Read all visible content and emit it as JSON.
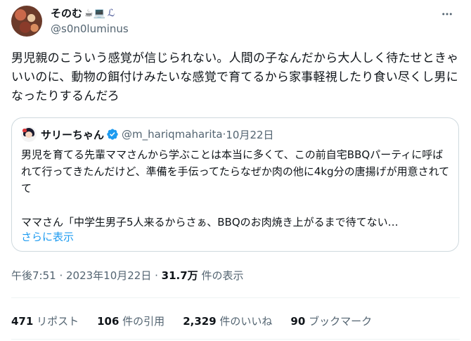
{
  "author": {
    "name": "そのむ",
    "name_emoji": "☕💻",
    "name_glyph": "ℒ",
    "handle": "@s0n0luminus"
  },
  "tweet": {
    "text": "男児親のこういう感覚が信じられない。人間の子なんだから大人しく待たせときゃいいのに、動物の餌付けみたいな感覚で育てるから家事軽視したり食い尽くし男になったりするんだろ"
  },
  "quote": {
    "name": "サリーちゃん",
    "handle": "@m_hariqmaharita",
    "separator": " · ",
    "date": "10月22日",
    "text": "男児を育てる先輩ママさんから学ぶことは本当に多くて、この前自宅BBQパーティに呼ばれて行ってきたんだけど、準備を手伝ってたらなぜか肉の他に4kg分の唐揚げが用意されてて\n\nママさん「中学生男子5人来るからさぁ、BBQのお肉焼き上がるまで待てない…",
    "show_more": "さらに表示"
  },
  "meta": {
    "time": "午後7:51",
    "sep": " · ",
    "date": "2023年10月22日",
    "sep2": " · ",
    "views_count": "31.7万",
    "views_label": " 件の表示"
  },
  "stats": [
    {
      "num": "471",
      "label": " リポスト"
    },
    {
      "num": "106",
      "label": " 件の引用"
    },
    {
      "num": "2,329",
      "label": " 件のいいね"
    },
    {
      "num": "90",
      "label": " ブックマーク"
    }
  ],
  "colors": {
    "text": "#0f1419",
    "secondary": "#536471",
    "link": "#1d9bf0",
    "border": "#cfd9de",
    "verified": "#1d9bf0"
  },
  "icons": [
    "more-icon",
    "verified-badge-icon"
  ]
}
